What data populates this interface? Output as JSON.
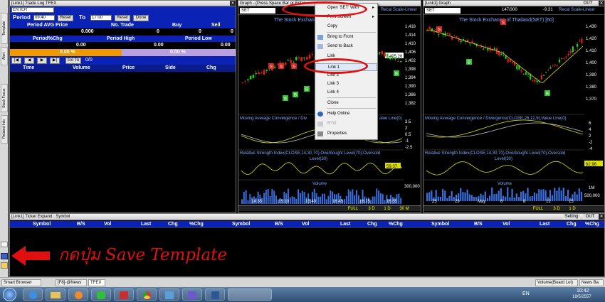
{
  "left_tabs": [
    "Template",
    "Alert",
    "Stock Focus",
    "Related Info"
  ],
  "trade_log": {
    "title": "[Link1] Trade Log TFEX",
    "symbol_value": "ENTER",
    "period_label": "Period",
    "from_time": "09:40",
    "to_label": "To",
    "to_time": "17:00",
    "reset1": "Reset",
    "reset2": "Reset",
    "done": "Done",
    "row1_headers": [
      "Period AVG Price",
      "No. Trade",
      "Buy",
      "Sell"
    ],
    "row1_values": [
      "0.000",
      "0",
      "0",
      "0"
    ],
    "row2_headers": [
      "Period%Chg",
      "Period High",
      "Period Low"
    ],
    "row2_values": [
      "0.00",
      "0.00",
      "0.00"
    ],
    "pct_left": "0.00 %",
    "pct_right": "0.00 %",
    "goto_label": "Go To",
    "page": "0/0",
    "table_headers": [
      "Time",
      "Volume",
      "Price",
      "Side",
      "Chg"
    ]
  },
  "graph1": {
    "title": "Graph - (Press Space Bar or Enter",
    "symbol": "SET",
    "chart_name": "The Stock Exchange",
    "y_ticks": [
      "1,418",
      "1,414",
      "1,410",
      "1,406",
      "1,402",
      "1,398",
      "1,394",
      "1,390",
      "1,386",
      "1,382"
    ],
    "last_price": "1,405.26",
    "macd_title": "Moving Average Convergence / Div",
    "macd_title_tail": "alue Line(0)",
    "macd_ticks": [
      "3.5",
      "2",
      "0.5",
      "-1",
      "-2.5"
    ],
    "rsi_title": "Relative Strength Index(CLOSE,14,30,70),Overbought Level(70),Oversold",
    "rsi_title2": "Level(30)",
    "rsi_value": "59.37",
    "volume_title": "Volume",
    "volume_tick": "300,000",
    "x_labels": [
      "14:35",
      "15:10",
      "15:40",
      "16:45",
      "16:25",
      "16:55"
    ],
    "x_sub": "16",
    "nav": [
      "FULL",
      "3 D",
      "1 D",
      "30 M"
    ]
  },
  "graph2": {
    "title": "[Link1] Graph",
    "symbol": "SET",
    "counter": "147/300",
    "change": "-9.31",
    "scale": "Recal Scale-Linear",
    "chart_name": "The Stock Exchange of Thailand(SET) [60]",
    "y_ticks": [
      "1,430",
      "1,420",
      "1,410",
      "1,400",
      "1,390",
      "1,380",
      "1,370"
    ],
    "macd_title": "Moving Average Convergence / Divergence(CLOSE,26,12,9),Value Line(0)",
    "macd_ticks": [
      "6",
      "4",
      "2",
      "-2",
      "-4"
    ],
    "rsi_title": "Relative Strength Index(CLOSE,14,30,70),Overbought Level(70),Oversold",
    "rsi_title2": "Level(30)",
    "rsi_value": "62.96",
    "volume_title": "Volume",
    "volume_ticks": [
      "1M",
      "500,000"
    ],
    "x_labels": [
      "25",
      "29",
      "May",
      "6",
      "8",
      "12",
      "15"
    ],
    "nav": [
      "FULL",
      "3 D",
      "1 D"
    ]
  },
  "graph1_scale": "Recal Scale-Linear",
  "context_menu": {
    "items": [
      "Open 'SET' With",
      "Print Screen",
      "Copy",
      "Bring to Front",
      "Send to Back",
      "Link",
      "Link 1",
      "Link 2",
      "Link 3",
      "Link 4",
      "Clone",
      "Help Online",
      "RTO",
      "Properties"
    ]
  },
  "ticker": {
    "title": "[Link1] Ticker Expand : Symbol",
    "setting": "Setting",
    "out": "OUT",
    "headers": [
      "Symbol",
      "B/S",
      "Vol",
      "Last",
      "Chg",
      "%Chg",
      "Symbol",
      "B/S",
      "Vol",
      "Last",
      "Chg",
      "%Chg",
      "Symbol",
      "B/S",
      "Vol",
      "Last",
      "Chg",
      "%Chg"
    ]
  },
  "annotation": "กดปุ่ม Save Template",
  "tabstrip": {
    "tabs": [
      "Smart Browser",
      "[F8]-@News",
      "TFEX"
    ],
    "right_tabs": [
      "Volume(Board Lot)",
      "News Ba"
    ]
  },
  "taskbar": {
    "lang": "EN",
    "time": "10:42",
    "date": "18/5/2557"
  },
  "colors": {
    "panel_blue": "#0a23b4",
    "highlight_red": "#e01010",
    "candle_up": "#22cc22",
    "candle_down": "#e02020"
  }
}
